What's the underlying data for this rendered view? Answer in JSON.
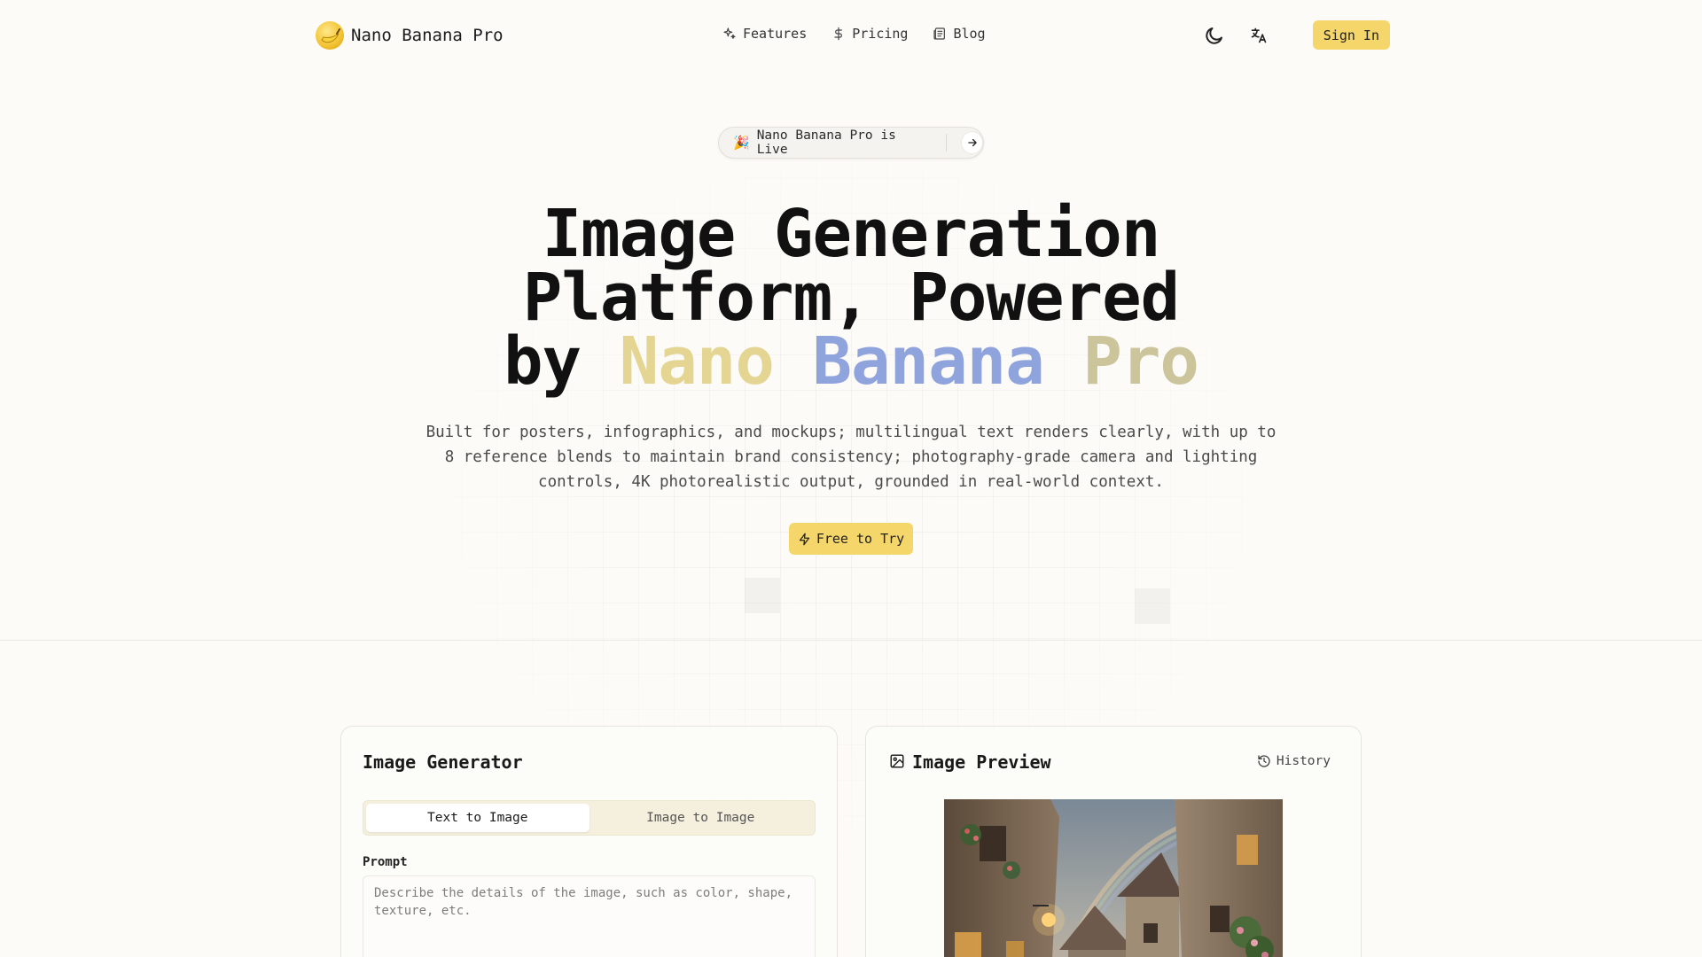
{
  "header": {
    "brand_name": "Nano Banana Pro",
    "nav": [
      {
        "label": "Features",
        "icon": "sparkles-icon"
      },
      {
        "label": "Pricing",
        "icon": "dollar-icon"
      },
      {
        "label": "Blog",
        "icon": "newspaper-icon"
      }
    ],
    "theme_toggle_icon": "moon-icon",
    "language_icon": "translate-icon",
    "sign_in_label": "Sign In"
  },
  "hero": {
    "announcement_emoji": "🎉",
    "announcement_text": "Nano Banana Pro is Live",
    "title_line1": "Image Generation",
    "title_line2": "Platform, Powered",
    "title_by": "by",
    "title_word_nano": "Nano",
    "title_word_banana": "Banana",
    "title_word_pro": "Pro",
    "subtitle": "Built for posters, infographics, and mockups; multilingual text renders clearly, with up to 8 reference blends to maintain brand consistency; photography-grade camera and lighting controls, 4K photorealistic output, grounded in real-world context.",
    "cta_label": "Free to Try"
  },
  "generator": {
    "title": "Image Generator",
    "tabs": [
      {
        "label": "Text to Image",
        "active": true
      },
      {
        "label": "Image to Image",
        "active": false
      }
    ],
    "prompt_label": "Prompt",
    "prompt_placeholder": "Describe the details of the image, such as color, shape, texture, etc.",
    "prompt_value": ""
  },
  "preview": {
    "title": "Image Preview",
    "history_label": "History"
  },
  "colors": {
    "accent": "#f5d66a",
    "background": "#fcfbf8",
    "nano": "#e4d592",
    "banana": "#8fa3dc",
    "pro": "#ccc49a"
  }
}
